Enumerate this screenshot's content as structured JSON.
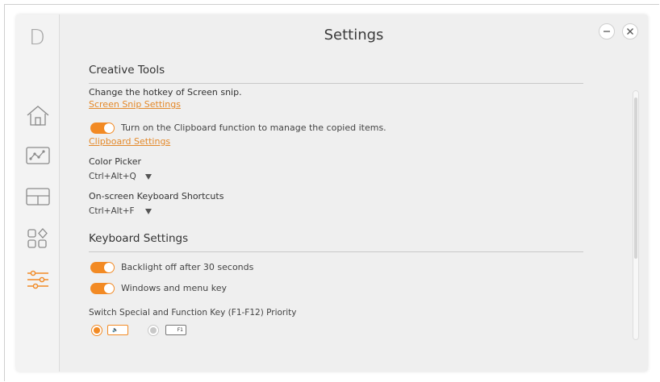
{
  "app": {
    "logo": "D",
    "title": "Settings"
  },
  "sidebar": {
    "items": [
      {
        "name": "home-icon",
        "active": false
      },
      {
        "name": "mouse-icon",
        "active": false
      },
      {
        "name": "layout-icon",
        "active": false
      },
      {
        "name": "apps-icon",
        "active": false
      },
      {
        "name": "sliders-icon",
        "active": true
      }
    ]
  },
  "creative_tools": {
    "title": "Creative Tools",
    "screen_snip_label": "Change the hotkey of Screen snip.",
    "screen_snip_link": "Screen Snip Settings",
    "clipboard_toggle_on": true,
    "clipboard_toggle_label": "Turn on the Clipboard function to manage the copied items.",
    "clipboard_link": "Clipboard Settings",
    "color_picker_label": "Color Picker",
    "color_picker_value": "Ctrl+Alt+Q",
    "keyboard_shortcuts_label": "On-screen Keyboard Shortcuts",
    "keyboard_shortcuts_value": "Ctrl+Alt+F"
  },
  "keyboard_settings": {
    "title": "Keyboard Settings",
    "backlight_toggle_on": true,
    "backlight_label": "Backlight off after 30 seconds",
    "windows_key_toggle_on": true,
    "windows_key_label": "Windows and menu key",
    "priority_label": "Switch Special and Function Key (F1-F12) Priority",
    "priority_option_special_selected": true,
    "priority_option_special_key": "🔈",
    "priority_option_fn_key": "F1"
  },
  "colors": {
    "accent": "#f28a24",
    "link": "#e4892a",
    "background": "#efefef"
  }
}
